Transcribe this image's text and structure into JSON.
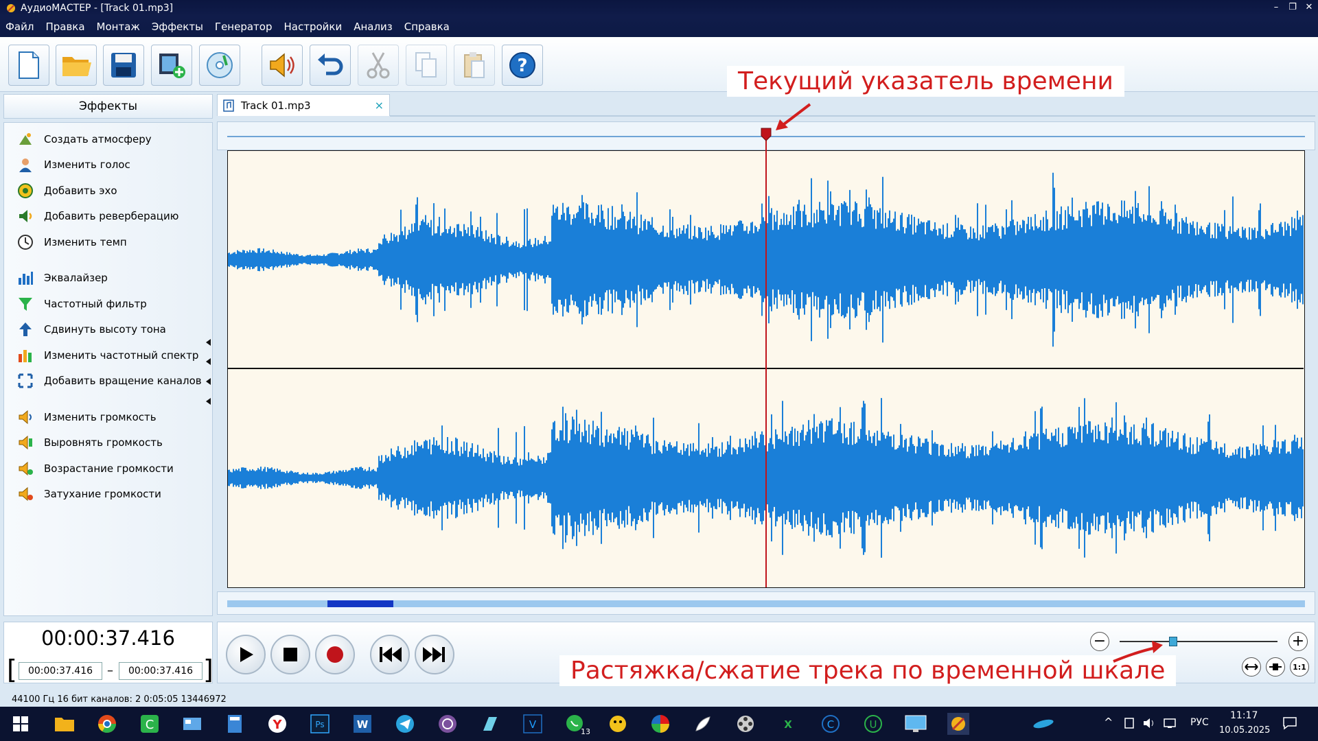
{
  "window": {
    "title": "АудиоМАСТЕР - [Track 01.mp3]",
    "min": "–",
    "restore": "❐",
    "close": "✕"
  },
  "menu": [
    "Файл",
    "Правка",
    "Монтаж",
    "Эффекты",
    "Генератор",
    "Настройки",
    "Анализ",
    "Справка"
  ],
  "toolbar": {
    "icons": [
      "new-file-icon",
      "open-folder-icon",
      "save-icon",
      "add-video-icon",
      "cd-rip-icon",
      "speaker-icon",
      "undo-icon",
      "scissors-icon",
      "copy-icon",
      "paste-icon",
      "help-icon"
    ],
    "disabled": [
      "scissors-icon",
      "copy-icon",
      "paste-icon"
    ]
  },
  "sidebar": {
    "title": "Эффекты",
    "items": [
      {
        "label": "Создать атмосферу",
        "icon": "atmosphere-icon"
      },
      {
        "label": "Изменить голос",
        "icon": "voice-icon"
      },
      {
        "label": "Добавить эхо",
        "icon": "echo-icon"
      },
      {
        "label": "Добавить реверберацию",
        "icon": "reverb-icon"
      },
      {
        "label": "Изменить темп",
        "icon": "tempo-icon"
      },
      {
        "label": "Эквалайзер",
        "icon": "equalizer-icon"
      },
      {
        "label": "Частотный фильтр",
        "icon": "filter-icon"
      },
      {
        "label": "Сдвинуть высоту тона",
        "icon": "pitch-icon"
      },
      {
        "label": "Изменить частотный спектр",
        "icon": "spectrum-icon"
      },
      {
        "label": "Добавить вращение каналов",
        "icon": "rotate-channels-icon"
      },
      {
        "label": "Изменить громкость",
        "icon": "volume-icon"
      },
      {
        "label": "Выровнять громкость",
        "icon": "normalize-icon"
      },
      {
        "label": "Возрастание громкости",
        "icon": "fade-in-icon"
      },
      {
        "label": "Затухание громкости",
        "icon": "fade-out-icon"
      }
    ]
  },
  "tab": {
    "label": "Track 01.mp3",
    "close": "×"
  },
  "playhead": {
    "position_fraction": 0.5
  },
  "scroll": {
    "view_start_fraction": 0.093,
    "view_end_fraction": 0.154
  },
  "time": {
    "current": "00:00:37.416",
    "sel_start": "00:00:37.416",
    "separator": "–",
    "sel_end": "00:00:37.416"
  },
  "zoom": {
    "minus": "−",
    "plus": "+",
    "level_fraction": 0.34,
    "fit_label": "1:1"
  },
  "status": {
    "text": "44100 Гц  16 бит  каналов: 2  0:05:05 13446972"
  },
  "annotations": {
    "playhead": "Текущий указатель времени",
    "zoom": "Растяжка/сжатие трека по временной шкале"
  },
  "taskbar": {
    "lang": "РУС",
    "time": "11:17",
    "date": "10.05.2025",
    "badge": "13"
  },
  "colors": {
    "waveform": "#1a7fd8",
    "wave_bg": "#fdf8ec",
    "playhead": "#c0141b",
    "annotation": "#d21e1e"
  }
}
